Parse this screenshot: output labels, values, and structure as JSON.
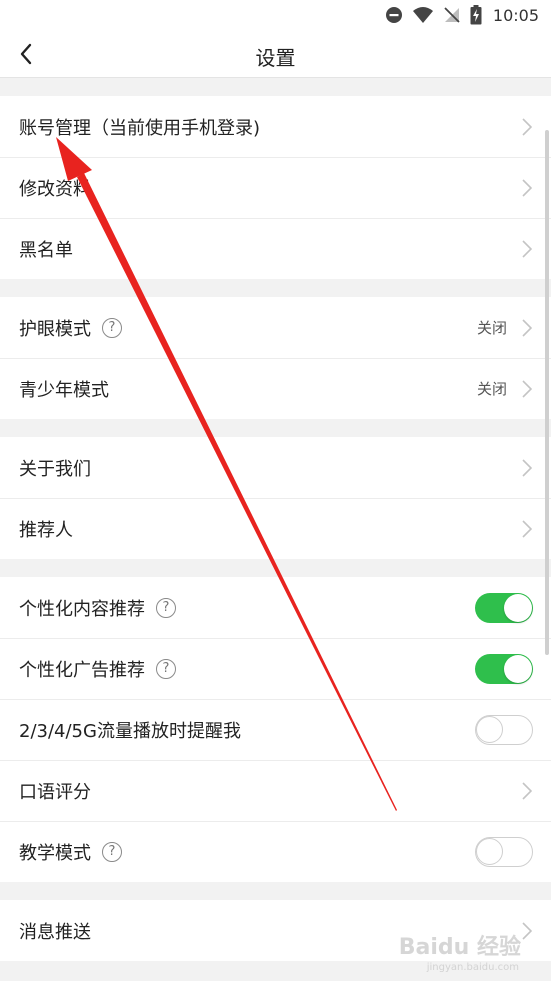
{
  "status_bar": {
    "time": "10:05"
  },
  "nav": {
    "title": "设置"
  },
  "groups": [
    {
      "rows": [
        {
          "label": "账号管理（当前使用手机登录)",
          "control": "chevron"
        },
        {
          "label": "修改资料",
          "control": "chevron"
        },
        {
          "label": "黑名单",
          "control": "chevron"
        }
      ]
    },
    {
      "rows": [
        {
          "label": "护眼模式",
          "help": true,
          "value": "关闭",
          "control": "chevron"
        },
        {
          "label": "青少年模式",
          "value": "关闭",
          "control": "chevron"
        }
      ]
    },
    {
      "rows": [
        {
          "label": "关于我们",
          "control": "chevron"
        },
        {
          "label": "推荐人",
          "control": "chevron"
        }
      ]
    },
    {
      "rows": [
        {
          "label": "个性化内容推荐",
          "help": true,
          "control": "toggle",
          "toggle_on": true
        },
        {
          "label": "个性化广告推荐",
          "help": true,
          "control": "toggle",
          "toggle_on": true
        },
        {
          "label": "2/3/4/5G流量播放时提醒我",
          "control": "toggle",
          "toggle_on": false
        },
        {
          "label": "口语评分",
          "control": "chevron"
        },
        {
          "label": "教学模式",
          "help": true,
          "control": "toggle",
          "toggle_on": false
        }
      ]
    },
    {
      "rows": [
        {
          "label": "消息推送",
          "control": "chevron"
        }
      ]
    }
  ],
  "help_glyph": "?",
  "colors": {
    "toggle_on": "#2fbf4c",
    "annotation_arrow": "#e8231f"
  },
  "watermark": {
    "text": "Baidu 经验",
    "sub": "jingyan.baidu.com"
  }
}
